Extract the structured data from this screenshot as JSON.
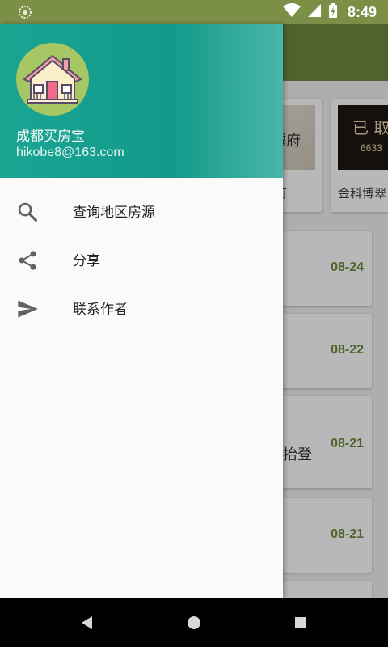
{
  "status_bar": {
    "time": "8:49"
  },
  "background": {
    "card_captions": [
      "府",
      "金科博翠"
    ],
    "card1_thumb_text": "越府",
    "card2_thumb_text": "已 取",
    "card2_thumb_sub": "6633",
    "news_rows": [
      {
        "date": "08-24",
        "snippet": ""
      },
      {
        "date": "08-22",
        "snippet": ""
      },
      {
        "date": "08-21",
        "snippet": "抬登"
      },
      {
        "date": "08-21",
        "snippet": ""
      }
    ]
  },
  "drawer": {
    "app_name": "成都买房宝",
    "email": "hikobe8@163.com",
    "menu": [
      {
        "label": "查询地区房源",
        "icon": "search-icon"
      },
      {
        "label": "分享",
        "icon": "share-icon"
      },
      {
        "label": "联系作者",
        "icon": "send-icon"
      }
    ]
  },
  "colors": {
    "status_bar": "#7c8f47",
    "toolbar": "#6f8a3f",
    "drawer_header": "#12998a",
    "date_accent": "#6f8a3f"
  }
}
